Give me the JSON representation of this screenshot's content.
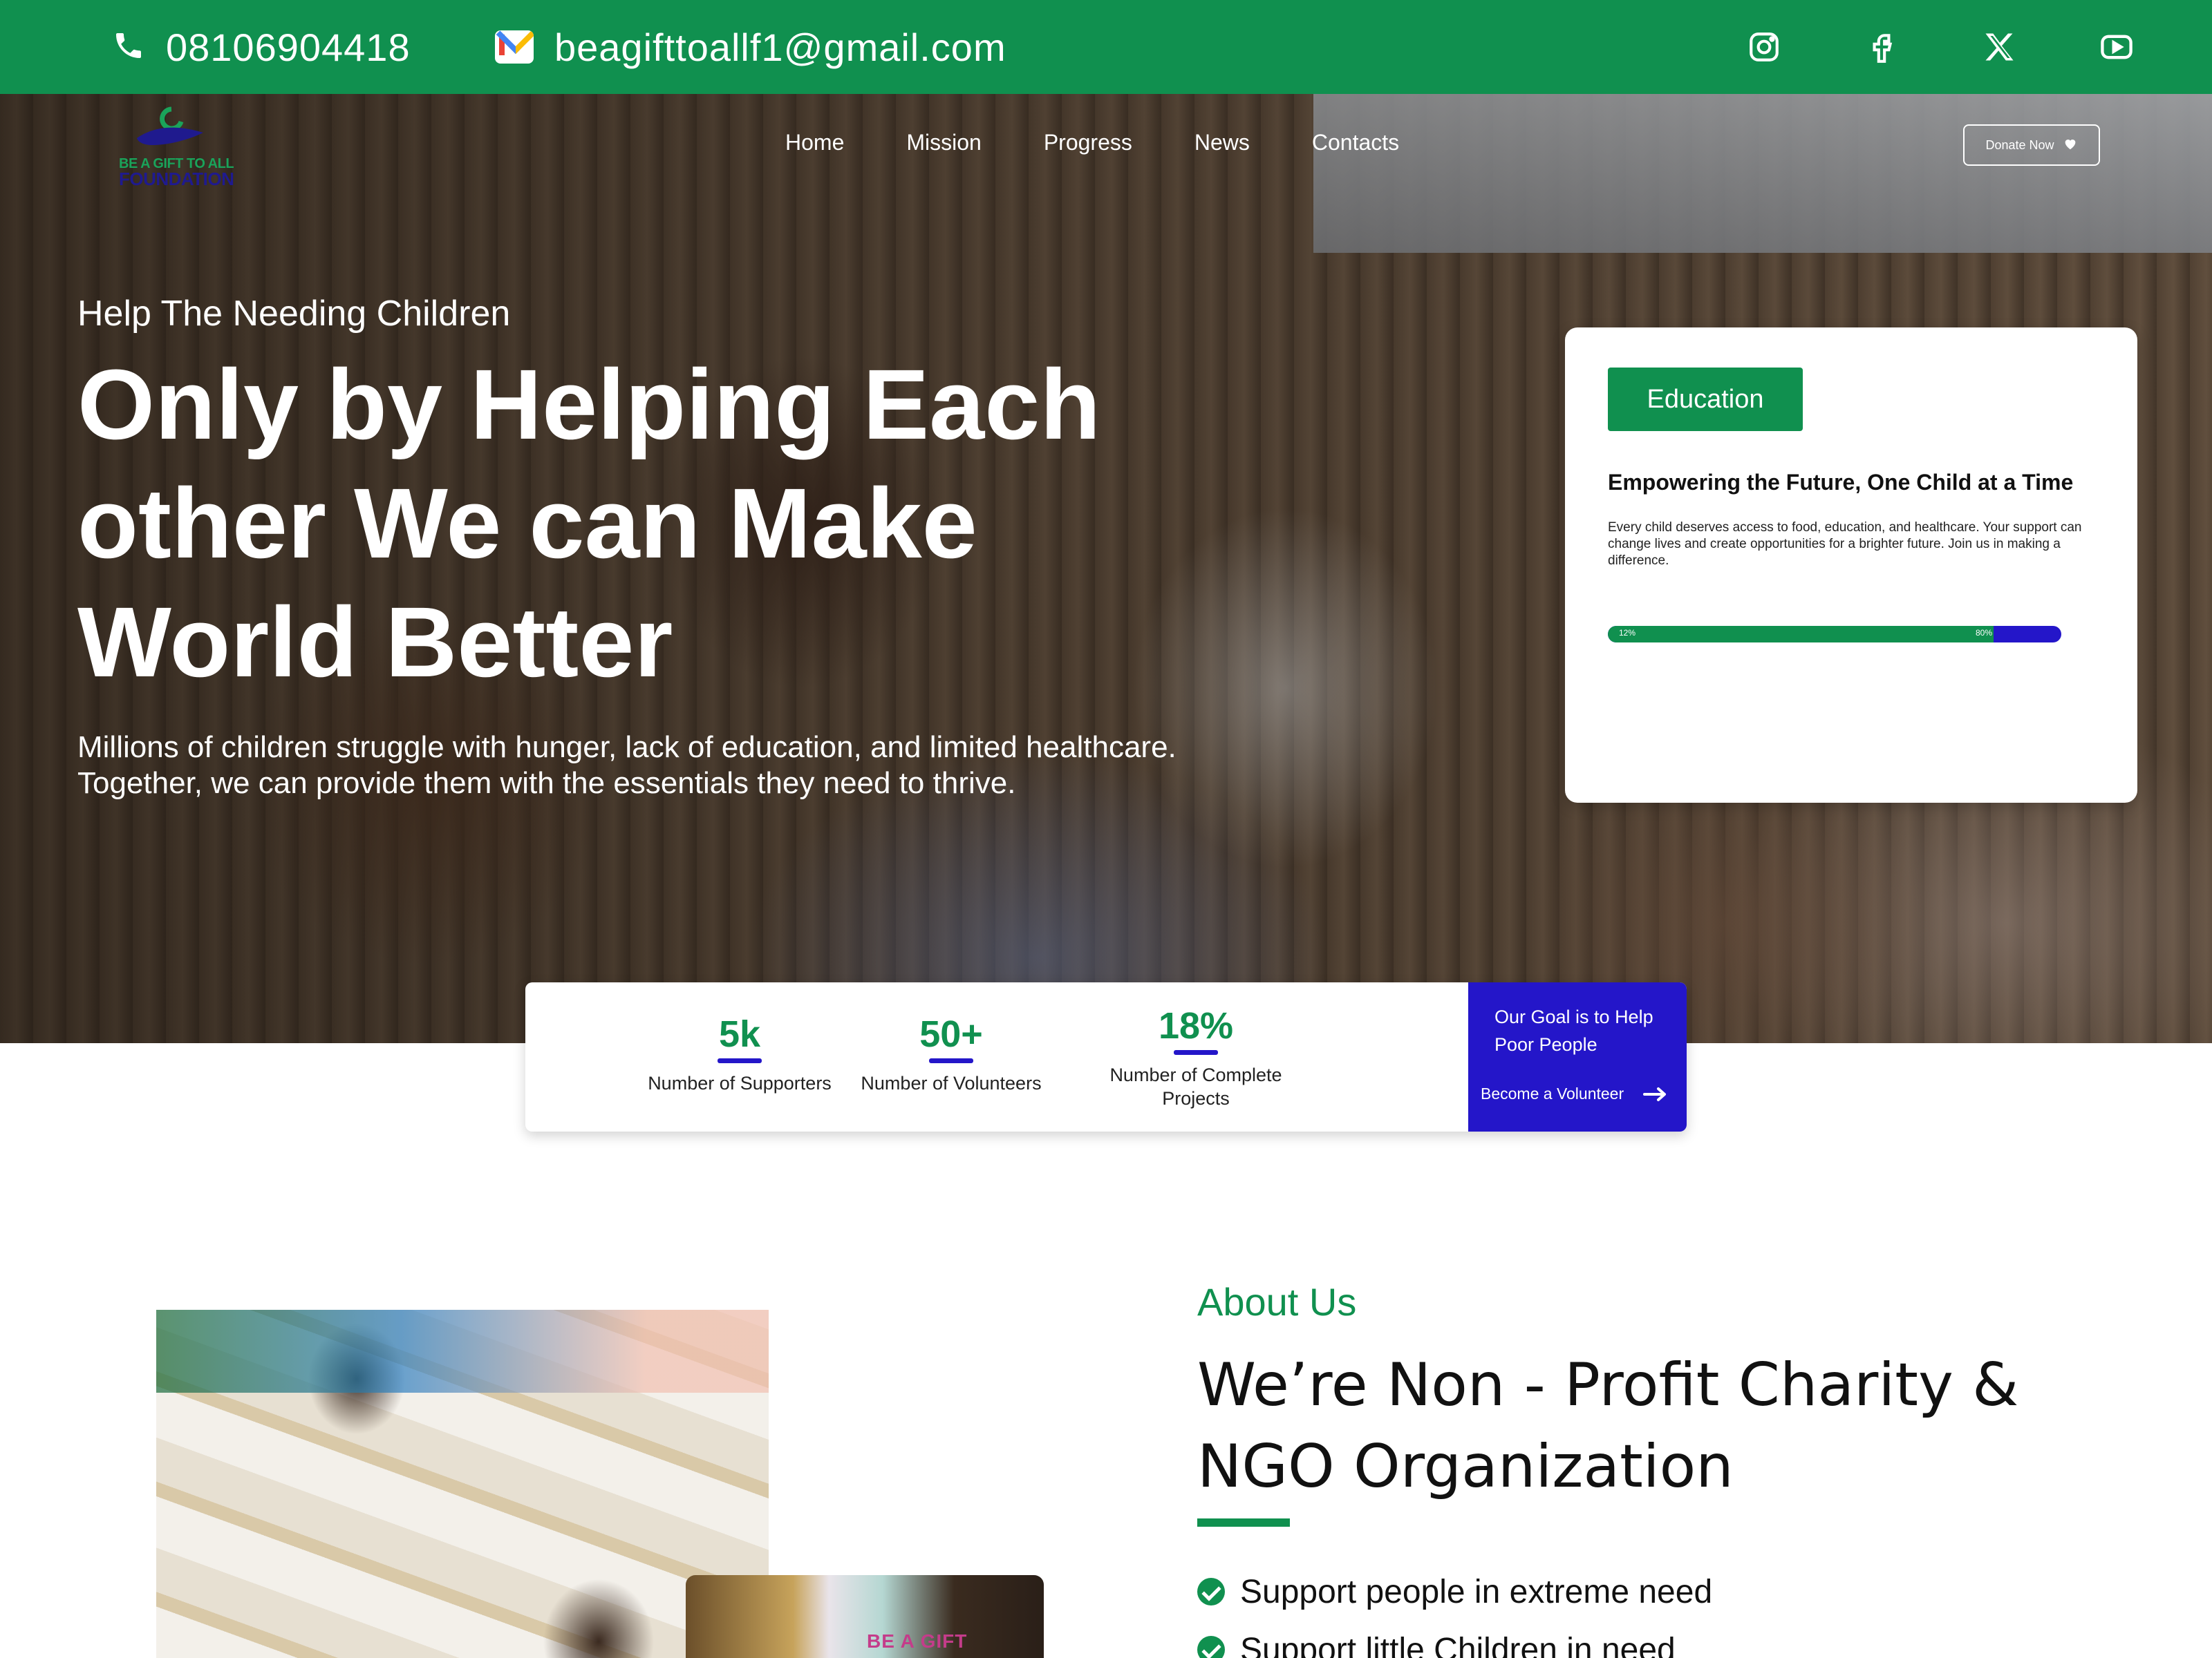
{
  "topbar": {
    "phone": "08106904418",
    "email": "beagifttoallf1@gmail.com",
    "socials": [
      "instagram-icon",
      "facebook-icon",
      "x-icon",
      "youtube-icon"
    ],
    "bg_color": "#10904f"
  },
  "brand": {
    "logo_line1": "BE A GIFT TO ALL",
    "logo_line2": "FOUNDATION"
  },
  "nav": {
    "items": [
      "Home",
      "Mission",
      "Progress",
      "News",
      "Contacts"
    ],
    "donate_label": "Donate Now"
  },
  "hero": {
    "subtitle": "Help The Needing Children",
    "title": "Only by Helping Each other We can Make World Better",
    "description": "Millions of children struggle with hunger, lack of education, and limited healthcare. Together, we can provide them with the essentials they need to thrive."
  },
  "education_card": {
    "tag": "Education",
    "heading": "Empowering the Future, One Child at a Time",
    "text": "Every child deserves access to food, education, and healthcare. Your support can change lives and create opportunities for a brighter future. Join us in making a difference.",
    "progress_fraction": 0.85,
    "progress_left_label": "12%",
    "progress_right_label": "80%"
  },
  "stats": {
    "items": [
      {
        "value": "5k",
        "label": "Number of Supporters"
      },
      {
        "value": "50+",
        "label": "Number of Volunteers"
      },
      {
        "value": "18%",
        "label": "Number of Complete Projects"
      }
    ],
    "goal_text": "Our Goal is to Help Poor People",
    "goal_link": "Become a Volunteer"
  },
  "about": {
    "kicker": "About Us",
    "title": "We’re Non - Profit Charity  & NGO Organization",
    "list": [
      "Support people in extreme need",
      "Support little Children in need"
    ],
    "banner_text": "BE A GIFT"
  },
  "colors": {
    "green": "#10904f",
    "blue": "#2416c9"
  }
}
